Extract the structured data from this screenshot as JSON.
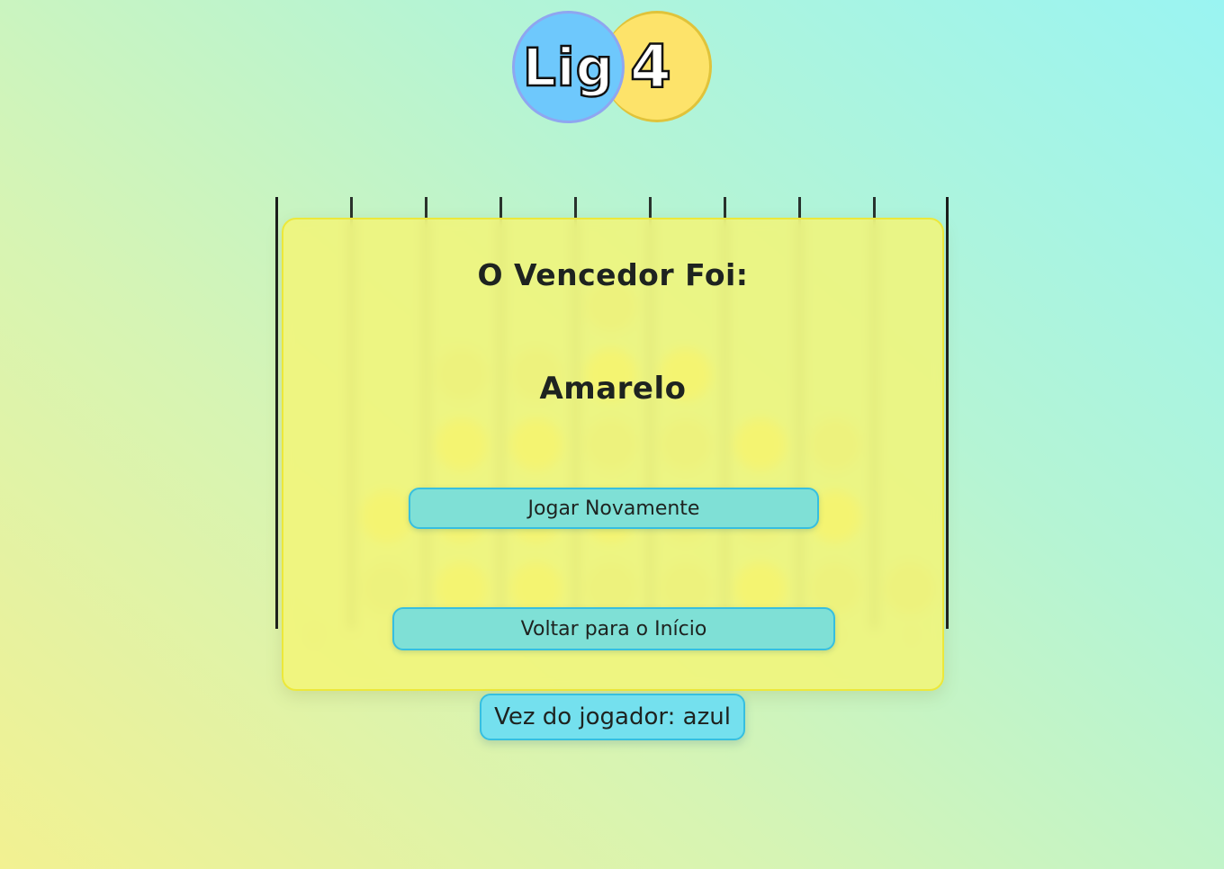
{
  "logo": {
    "left_text": "Lig",
    "right_text": "4",
    "left_color": "#6ec8fc",
    "right_color": "#fde36a"
  },
  "board": {
    "columns": 9,
    "rows": 5,
    "player_colors": {
      "amarelo": "#fff04a",
      "azul": "#cfe19a"
    },
    "grid_top_to_bottom": [
      [
        "",
        "",
        "",
        "",
        "b",
        "",
        "",
        "",
        ""
      ],
      [
        "",
        "",
        "b",
        "b",
        "y",
        "y",
        "",
        "",
        ""
      ],
      [
        "",
        "",
        "y",
        "y",
        "b",
        "b",
        "y",
        "b",
        ""
      ],
      [
        "",
        "y",
        "y",
        "y",
        "y",
        "b",
        "b",
        "y",
        ""
      ],
      [
        "",
        "b",
        "y",
        "y",
        "b",
        "b",
        "y",
        "b",
        "b"
      ]
    ],
    "column_arrow_icon": "arrow-up-icon"
  },
  "modal": {
    "title": "O Vencedor Foi:",
    "winner": "Amarelo",
    "play_again_label": "Jogar Novamente",
    "back_home_label": "Voltar para o Início"
  },
  "status": {
    "turn_text": "Vez do jogador: azul"
  }
}
